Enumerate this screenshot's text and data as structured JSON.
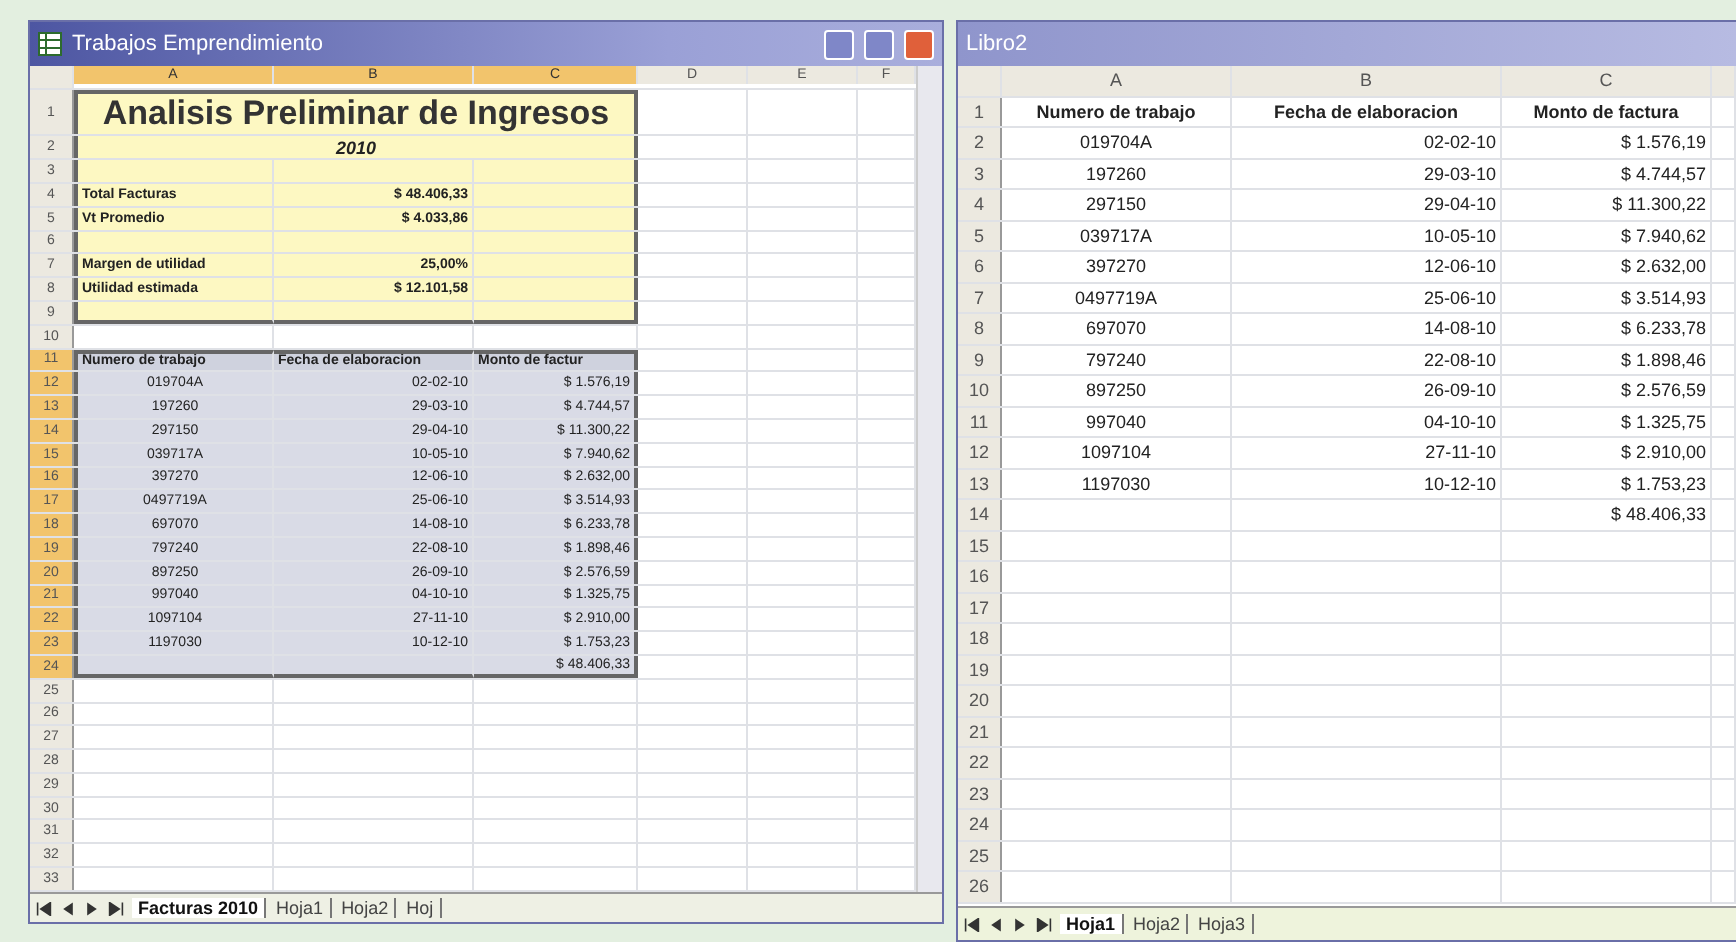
{
  "left_window": {
    "title": "Trabajos Emprendimiento",
    "columns": [
      {
        "label": "A",
        "selected": true
      },
      {
        "label": "B",
        "selected": true
      },
      {
        "label": "C",
        "selected": true
      },
      {
        "label": "D",
        "selected": false
      },
      {
        "label": "E",
        "selected": false
      },
      {
        "label": "F",
        "selected": false
      }
    ],
    "rows": [
      {
        "number": "1",
        "kind": "title",
        "selected": false,
        "cells": [
          "Analisis Preliminar de Ingresos"
        ]
      },
      {
        "number": "2",
        "kind": "subtitle",
        "selected": false,
        "cells": [
          "2010"
        ]
      },
      {
        "number": "3",
        "kind": "box",
        "selected": false,
        "cells": []
      },
      {
        "number": "4",
        "kind": "summary",
        "selected": false,
        "cells": [
          "Total Facturas",
          "$ 48.406,33"
        ]
      },
      {
        "number": "5",
        "kind": "summary",
        "selected": false,
        "cells": [
          "Vt Promedio",
          "$ 4.033,86"
        ]
      },
      {
        "number": "6",
        "kind": "box",
        "selected": false,
        "cells": []
      },
      {
        "number": "7",
        "kind": "summary",
        "selected": false,
        "cells": [
          "Margen de utilidad",
          "25,00%"
        ]
      },
      {
        "number": "8",
        "kind": "summary",
        "selected": false,
        "cells": [
          "Utilidad estimada",
          "$ 12.101,58"
        ]
      },
      {
        "number": "9",
        "kind": "box-end",
        "selected": false,
        "cells": []
      },
      {
        "number": "10",
        "kind": "empty",
        "selected": false,
        "cells": []
      },
      {
        "number": "11",
        "kind": "header",
        "selected": true,
        "cells": [
          "Numero de trabajo",
          "Fecha de elaboracion",
          "Monto de factur"
        ]
      },
      {
        "number": "12",
        "kind": "data",
        "selected": true,
        "cells": [
          "019704A",
          "02-02-10",
          "$ 1.576,19"
        ]
      },
      {
        "number": "13",
        "kind": "data",
        "selected": true,
        "cells": [
          "197260",
          "29-03-10",
          "$ 4.744,57"
        ]
      },
      {
        "number": "14",
        "kind": "data",
        "selected": true,
        "cells": [
          "297150",
          "29-04-10",
          "$ 11.300,22"
        ]
      },
      {
        "number": "15",
        "kind": "data",
        "selected": true,
        "cells": [
          "039717A",
          "10-05-10",
          "$ 7.940,62"
        ]
      },
      {
        "number": "16",
        "kind": "data",
        "selected": true,
        "cells": [
          "397270",
          "12-06-10",
          "$ 2.632,00"
        ]
      },
      {
        "number": "17",
        "kind": "data",
        "selected": true,
        "cells": [
          "0497719A",
          "25-06-10",
          "$ 3.514,93"
        ]
      },
      {
        "number": "18",
        "kind": "data",
        "selected": true,
        "cells": [
          "697070",
          "14-08-10",
          "$ 6.233,78"
        ]
      },
      {
        "number": "19",
        "kind": "data",
        "selected": true,
        "cells": [
          "797240",
          "22-08-10",
          "$ 1.898,46"
        ]
      },
      {
        "number": "20",
        "kind": "data",
        "selected": true,
        "cells": [
          "897250",
          "26-09-10",
          "$ 2.576,59"
        ]
      },
      {
        "number": "21",
        "kind": "data",
        "selected": true,
        "cells": [
          "997040",
          "04-10-10",
          "$ 1.325,75"
        ]
      },
      {
        "number": "22",
        "kind": "data",
        "selected": true,
        "cells": [
          "1097104",
          "27-11-10",
          "$ 2.910,00"
        ]
      },
      {
        "number": "23",
        "kind": "data",
        "selected": true,
        "cells": [
          "1197030",
          "10-12-10",
          "$ 1.753,23"
        ]
      },
      {
        "number": "24",
        "kind": "total",
        "selected": true,
        "cells": [
          "",
          "",
          "$ 48.406,33"
        ]
      },
      {
        "number": "25",
        "kind": "empty",
        "selected": false,
        "cells": []
      },
      {
        "number": "26",
        "kind": "empty",
        "selected": false,
        "cells": []
      },
      {
        "number": "27",
        "kind": "empty",
        "selected": false,
        "cells": []
      },
      {
        "number": "28",
        "kind": "empty",
        "selected": false,
        "cells": []
      },
      {
        "number": "29",
        "kind": "empty",
        "selected": false,
        "cells": []
      },
      {
        "number": "30",
        "kind": "empty",
        "selected": false,
        "cells": []
      },
      {
        "number": "31",
        "kind": "empty",
        "selected": false,
        "cells": []
      },
      {
        "number": "32",
        "kind": "empty",
        "selected": false,
        "cells": []
      },
      {
        "number": "33",
        "kind": "empty",
        "selected": false,
        "cells": []
      }
    ],
    "sheet_tabs": [
      {
        "label": "Facturas 2010",
        "selected": true
      },
      {
        "label": "Hoja1",
        "selected": false
      },
      {
        "label": "Hoja2",
        "selected": false
      },
      {
        "label": "Hoj",
        "selected": false
      }
    ]
  },
  "right_window": {
    "title": "Libro2",
    "columns": [
      "A",
      "B",
      "C"
    ],
    "rows": [
      {
        "number": "1",
        "kind": "header",
        "cells": [
          "Numero de trabajo",
          "Fecha de elaboracion",
          "Monto de factura"
        ]
      },
      {
        "number": "2",
        "kind": "data",
        "cells": [
          "019704A",
          "02-02-10",
          "$ 1.576,19"
        ]
      },
      {
        "number": "3",
        "kind": "data",
        "cells": [
          "197260",
          "29-03-10",
          "$ 4.744,57"
        ]
      },
      {
        "number": "4",
        "kind": "data",
        "cells": [
          "297150",
          "29-04-10",
          "$ 11.300,22"
        ]
      },
      {
        "number": "5",
        "kind": "data",
        "cells": [
          "039717A",
          "10-05-10",
          "$ 7.940,62"
        ]
      },
      {
        "number": "6",
        "kind": "data",
        "cells": [
          "397270",
          "12-06-10",
          "$ 2.632,00"
        ]
      },
      {
        "number": "7",
        "kind": "data",
        "cells": [
          "0497719A",
          "25-06-10",
          "$ 3.514,93"
        ]
      },
      {
        "number": "8",
        "kind": "data",
        "cells": [
          "697070",
          "14-08-10",
          "$ 6.233,78"
        ]
      },
      {
        "number": "9",
        "kind": "data",
        "cells": [
          "797240",
          "22-08-10",
          "$ 1.898,46"
        ]
      },
      {
        "number": "10",
        "kind": "data",
        "cells": [
          "897250",
          "26-09-10",
          "$ 2.576,59"
        ]
      },
      {
        "number": "11",
        "kind": "data",
        "cells": [
          "997040",
          "04-10-10",
          "$ 1.325,75"
        ]
      },
      {
        "number": "12",
        "kind": "data",
        "cells": [
          "1097104",
          "27-11-10",
          "$ 2.910,00"
        ]
      },
      {
        "number": "13",
        "kind": "data",
        "cells": [
          "1197030",
          "10-12-10",
          "$ 1.753,23"
        ]
      },
      {
        "number": "14",
        "kind": "total",
        "cells": [
          "",
          "",
          "$ 48.406,33"
        ]
      },
      {
        "number": "15",
        "kind": "empty",
        "cells": []
      },
      {
        "number": "16",
        "kind": "empty",
        "cells": []
      },
      {
        "number": "17",
        "kind": "empty",
        "cells": []
      },
      {
        "number": "18",
        "kind": "empty",
        "cells": []
      },
      {
        "number": "19",
        "kind": "empty",
        "cells": []
      },
      {
        "number": "20",
        "kind": "empty",
        "cells": []
      },
      {
        "number": "21",
        "kind": "empty",
        "cells": []
      },
      {
        "number": "22",
        "kind": "empty",
        "cells": []
      },
      {
        "number": "23",
        "kind": "empty",
        "cells": []
      },
      {
        "number": "24",
        "kind": "empty",
        "cells": []
      },
      {
        "number": "25",
        "kind": "empty",
        "cells": []
      },
      {
        "number": "26",
        "kind": "empty",
        "cells": []
      }
    ],
    "sheet_tabs": [
      {
        "label": "Hoja1",
        "selected": true
      },
      {
        "label": "Hoja2",
        "selected": false
      },
      {
        "label": "Hoja3",
        "selected": false
      }
    ]
  }
}
